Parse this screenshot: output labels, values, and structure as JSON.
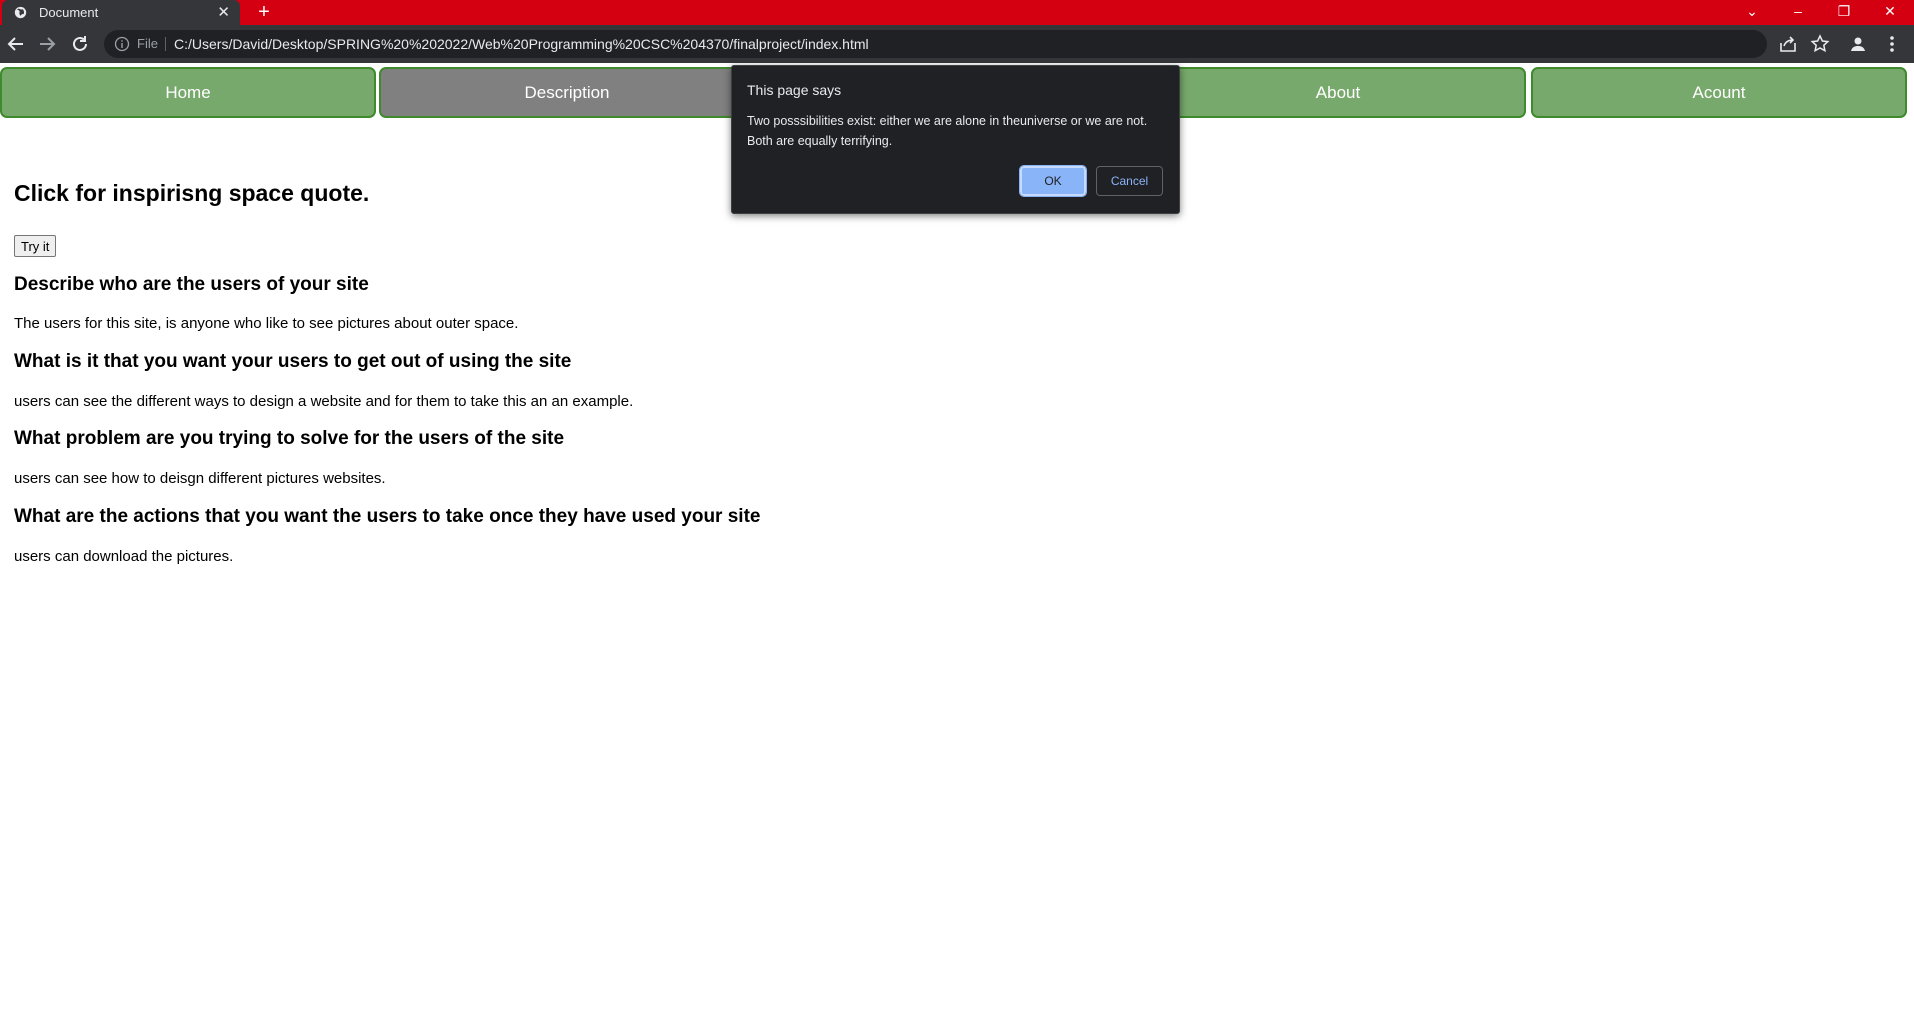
{
  "browser": {
    "tab": {
      "title": "Document",
      "close_glyph": "✕"
    },
    "new_tab_glyph": "+",
    "window_controls": {
      "tab_search": "⌄",
      "minimize": "–",
      "restore": "❐",
      "close": "✕"
    },
    "address_bar": {
      "scheme_label": "File",
      "url": "C:/Users/David/Desktop/SPRING%20%202022/Web%20Programming%20CSC%204370/finalproject/index.html"
    },
    "colors": {
      "tabstrip": "#d40012",
      "toolbar": "#35363a",
      "omnibox": "#202124"
    }
  },
  "nav": {
    "items": [
      {
        "label": "Home",
        "active": false
      },
      {
        "label": "Description",
        "active": true
      },
      {
        "label": "",
        "active": false
      },
      {
        "label": "About",
        "active": false
      },
      {
        "label": "Acount",
        "active": false
      }
    ],
    "colors": {
      "background": "#78a96c",
      "active": "#808080",
      "border": "#3f8a2c"
    }
  },
  "content": {
    "heading": "Click for inspirisng space quote.",
    "try_button": "Try it",
    "qa": [
      {
        "question": "Describe who are the users of your site",
        "answer": "The users for this site, is anyone who like to see pictures about outer space."
      },
      {
        "question": "What is it that you want your users to get out of using the site",
        "answer": "users can see the different ways to design a website and for them to take this an an example."
      },
      {
        "question": "What problem are you trying to solve for the users of the site",
        "answer": "users can see how to deisgn different pictures websites."
      },
      {
        "question": "What are the actions that you want the users to take once they have used your site",
        "answer": "users can download the pictures."
      }
    ]
  },
  "dialog": {
    "title": "This page says",
    "message": "Two posssibilities exist: either we are alone in theuniverse or we are not. Both are equally terrifying.",
    "ok_label": "OK",
    "cancel_label": "Cancel",
    "colors": {
      "background": "#202124",
      "ok": "#8ab4f8"
    }
  }
}
